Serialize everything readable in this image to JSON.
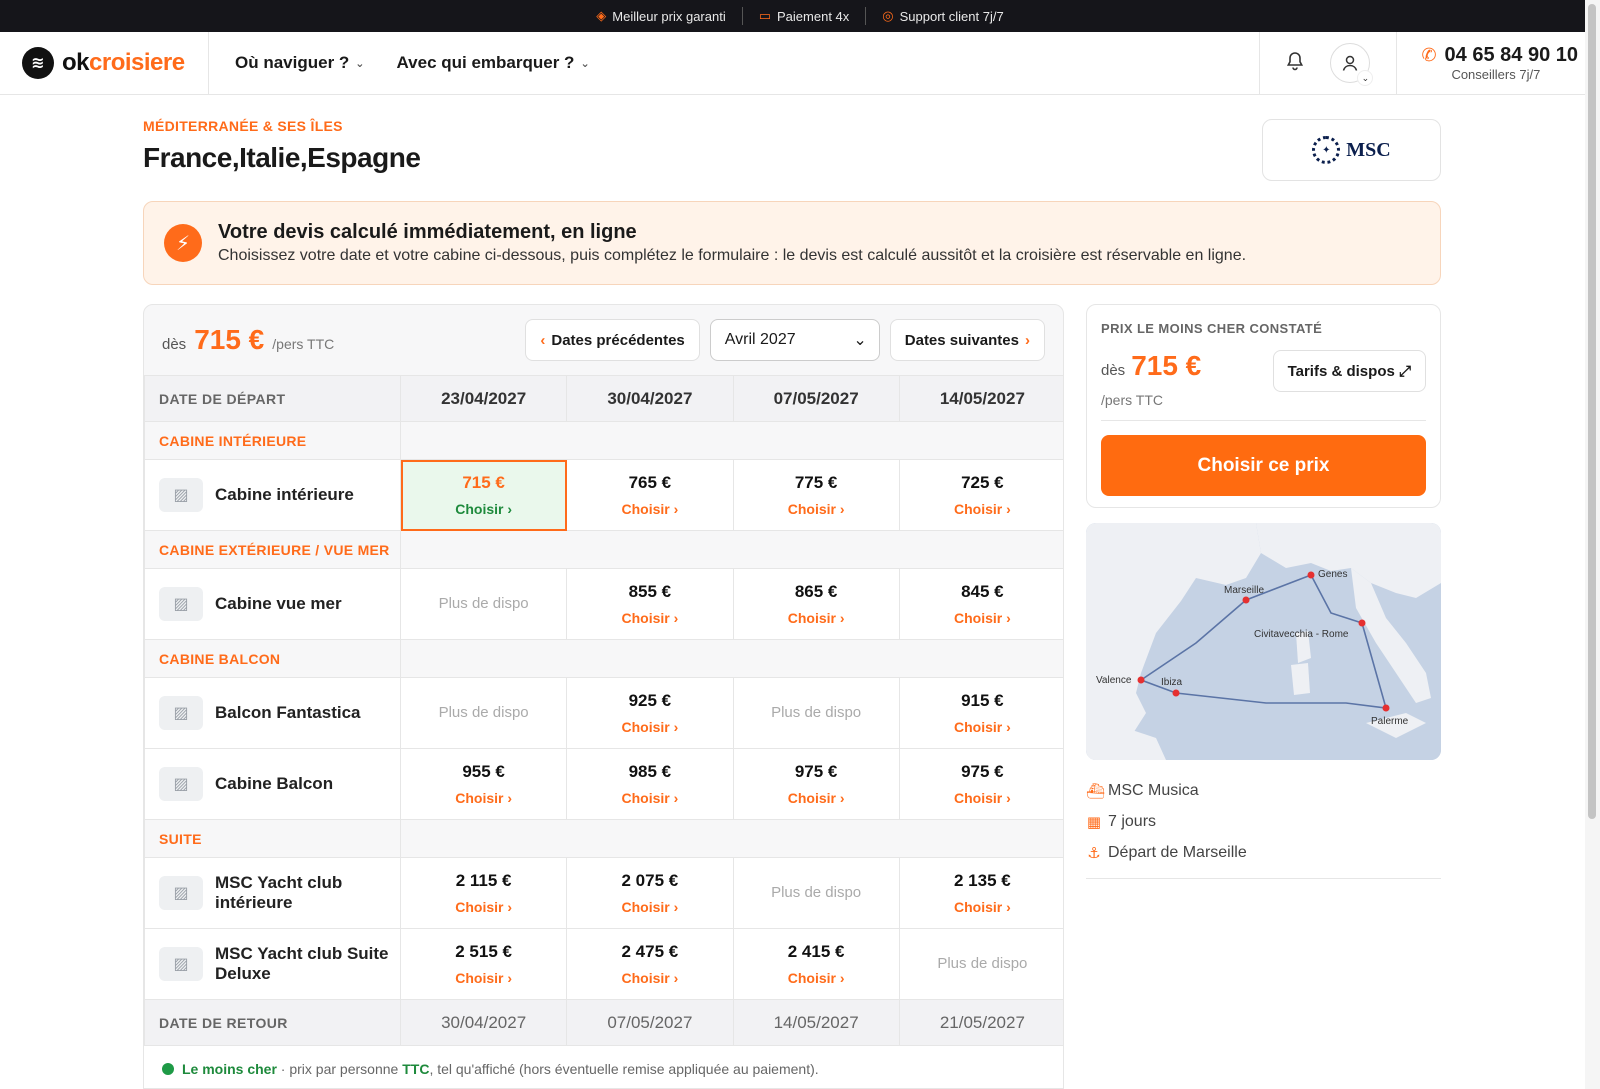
{
  "topbar": [
    {
      "icon": "tag-icon",
      "label": "Meilleur prix garanti"
    },
    {
      "icon": "card-icon",
      "label": "Paiement 4x"
    },
    {
      "icon": "headset-icon",
      "label": "Support client 7j/7"
    }
  ],
  "header": {
    "logo_ok": "ok",
    "logo_rest": "croisiere",
    "nav": [
      "Où naviguer ?",
      "Avec qui embarquer ?"
    ],
    "phone": "04 65 84 90 10",
    "phone_sub": "Conseillers 7j/7"
  },
  "cruise": {
    "region": "MÉDITERRANÉE & SES ÎLES",
    "title": "France,Italie,Espagne",
    "brand": "MSC"
  },
  "info": {
    "title": "Votre devis calculé immédiatement, en ligne",
    "text": "Choisissez votre date et votre cabine ci-dessous, puis complétez le formulaire : le devis est calculé aussitôt et la croisière est réservable en ligne."
  },
  "table": {
    "from_label": "dès",
    "from_price": "715 €",
    "per": "/pers TTC",
    "prev_label": "Dates précédentes",
    "next_label": "Dates suivantes",
    "month_selected": "Avril 2027",
    "depart_label": "DATE DE DÉPART",
    "return_label": "DATE DE RETOUR",
    "depart_dates": [
      "23/04/2027",
      "30/04/2027",
      "07/05/2027",
      "14/05/2027"
    ],
    "return_dates": [
      "30/04/2027",
      "07/05/2027",
      "14/05/2027",
      "21/05/2027"
    ],
    "choose": "Choisir ›",
    "nodispo": "Plus de dispo",
    "categories": [
      {
        "name": "CABINE INTÉRIEURE",
        "cabins": [
          {
            "name": "Cabine intérieure",
            "prices": [
              "715 €",
              "765 €",
              "775 €",
              "725 €"
            ]
          }
        ]
      },
      {
        "name": "CABINE EXTÉRIEURE / VUE MER",
        "cabins": [
          {
            "name": "Cabine vue mer",
            "prices": [
              null,
              "855 €",
              "865 €",
              "845 €"
            ]
          }
        ]
      },
      {
        "name": "CABINE BALCON",
        "cabins": [
          {
            "name": "Balcon Fantastica",
            "prices": [
              null,
              "925 €",
              null,
              "915 €"
            ]
          },
          {
            "name": "Cabine Balcon",
            "prices": [
              "955 €",
              "985 €",
              "975 €",
              "975 €"
            ]
          }
        ]
      },
      {
        "name": "SUITE",
        "cabins": [
          {
            "name": "MSC Yacht club intérieure",
            "prices": [
              "2 115 €",
              "2 075 €",
              null,
              "2 135 €"
            ]
          },
          {
            "name": "MSC Yacht club Suite Deluxe",
            "prices": [
              "2 515 €",
              "2 475 €",
              "2 415 €",
              null
            ]
          }
        ]
      }
    ],
    "legend_strong": "Le moins cher",
    "legend_mid": " · prix par personne ",
    "legend_ttc": "TTC",
    "legend_end": ", tel qu'affiché (hors éventuelle remise appliquée au paiement)."
  },
  "side": {
    "label": "PRIX LE MOINS CHER CONSTATÉ",
    "from": "dès",
    "price": "715 €",
    "per": "/pers TTC",
    "tarifs": "Tarifs & dispos ⤢",
    "cta": "Choisir ce prix"
  },
  "map": {
    "ports": [
      "Marseille",
      "Genes",
      "Civitavecchia - Rome",
      "Valence",
      "Ibiza",
      "Palerme"
    ]
  },
  "meta": [
    {
      "icon": "ship-icon",
      "label": "MSC Musica"
    },
    {
      "icon": "calendar-icon",
      "label": "7 jours"
    },
    {
      "icon": "anchor-icon",
      "label": "Départ de Marseille"
    }
  ]
}
